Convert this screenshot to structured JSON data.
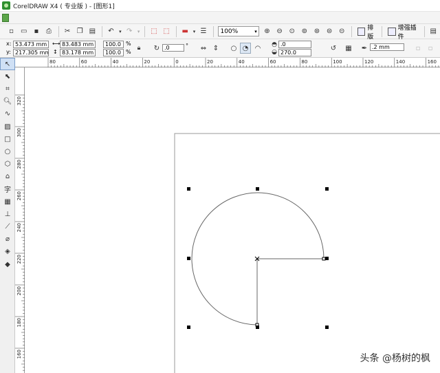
{
  "window": {
    "title": "CorelDRAW X4 ( 专业版 ) - [图形1]"
  },
  "toolbar": {
    "zoom_value": "100%",
    "arrange_label": "排版",
    "plugin_label": "增强插件"
  },
  "properties": {
    "x_label": "x:",
    "x_value": "53.473 mm",
    "y_label": "y:",
    "y_value": "217.305 mm",
    "width_value": "83.483 mm",
    "height_value": "83.178 mm",
    "scale_x": "100.0",
    "scale_y": "100.0",
    "percent": "%",
    "rotation_value": ".0",
    "degree": "°",
    "start_angle": ".0",
    "end_angle": "270.0",
    "outline_width": ".2 mm"
  },
  "rulers": {
    "horizontal_labels": [
      "80",
      "60",
      "40",
      "20",
      "0",
      "20",
      "40",
      "60",
      "80",
      "100",
      "120",
      "140",
      "160"
    ],
    "vertical_labels": [
      "320",
      "300",
      "280",
      "260",
      "240",
      "220",
      "200",
      "180",
      "160"
    ]
  },
  "toolbox": {
    "tools": [
      "pick-tool",
      "shape-tool",
      "crop-tool",
      "zoom-tool",
      "freehand-tool",
      "smart-fill-tool",
      "rectangle-tool",
      "ellipse-tool",
      "polygon-tool",
      "basic-shapes-tool",
      "text-tool",
      "table-tool",
      "dimension-tool",
      "eyedropper-tool",
      "outline-tool",
      "fill-tool",
      "interactive-fill-tool"
    ]
  },
  "watermark": {
    "text": "头条 @杨树的枫"
  },
  "colors": {
    "selection_handle": "#000000",
    "shape_outline": "#666666",
    "page_border": "#999999"
  }
}
